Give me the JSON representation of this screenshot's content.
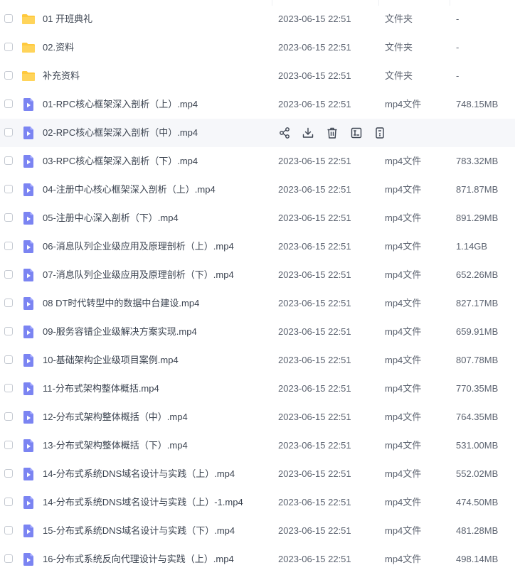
{
  "columns": {
    "date_color": "#5c6370"
  },
  "colors": {
    "folder": "#ffc93d",
    "video": "#7b84f2",
    "hover_row": "#f6f7fa",
    "action_icon": "#3b4350"
  },
  "hover_actions": [
    "share-icon",
    "download-icon",
    "delete-icon",
    "rename-icon",
    "more-icon"
  ],
  "files": [
    {
      "icon": "folder",
      "name": "01 开班典礼",
      "date": "2023-06-15 22:51",
      "type": "文件夹",
      "size": "-"
    },
    {
      "icon": "folder",
      "name": "02.资料",
      "date": "2023-06-15 22:51",
      "type": "文件夹",
      "size": "-"
    },
    {
      "icon": "folder",
      "name": "补充资料",
      "date": "2023-06-15 22:51",
      "type": "文件夹",
      "size": "-"
    },
    {
      "icon": "video",
      "name": "01-RPC核心框架深入剖析（上）.mp4",
      "date": "2023-06-15 22:51",
      "type": "mp4文件",
      "size": "748.15MB"
    },
    {
      "icon": "video",
      "name": "02-RPC核心框架深入剖析（中）.mp4",
      "hovered": true
    },
    {
      "icon": "video",
      "name": "03-RPC核心框架深入剖析（下）.mp4",
      "date": "2023-06-15 22:51",
      "type": "mp4文件",
      "size": "783.32MB"
    },
    {
      "icon": "video",
      "name": "04-注册中心核心框架深入剖析（上）.mp4",
      "date": "2023-06-15 22:51",
      "type": "mp4文件",
      "size": "871.87MB"
    },
    {
      "icon": "video",
      "name": "05-注册中心深入剖析（下）.mp4",
      "date": "2023-06-15 22:51",
      "type": "mp4文件",
      "size": "891.29MB"
    },
    {
      "icon": "video",
      "name": "06-消息队列企业级应用及原理剖析（上）.mp4",
      "date": "2023-06-15 22:51",
      "type": "mp4文件",
      "size": "1.14GB"
    },
    {
      "icon": "video",
      "name": "07-消息队列企业级应用及原理剖析（下）.mp4",
      "date": "2023-06-15 22:51",
      "type": "mp4文件",
      "size": "652.26MB"
    },
    {
      "icon": "video",
      "name": "08 DT时代转型中的数据中台建设.mp4",
      "date": "2023-06-15 22:51",
      "type": "mp4文件",
      "size": "827.17MB"
    },
    {
      "icon": "video",
      "name": "09-服务容错企业级解决方案实现.mp4",
      "date": "2023-06-15 22:51",
      "type": "mp4文件",
      "size": "659.91MB"
    },
    {
      "icon": "video",
      "name": "10-基础架构企业级项目案例.mp4",
      "date": "2023-06-15 22:51",
      "type": "mp4文件",
      "size": "807.78MB"
    },
    {
      "icon": "video",
      "name": "11-分布式架构整体概括.mp4",
      "date": "2023-06-15 22:51",
      "type": "mp4文件",
      "size": "770.35MB"
    },
    {
      "icon": "video",
      "name": "12-分布式架构整体概括（中）.mp4",
      "date": "2023-06-15 22:51",
      "type": "mp4文件",
      "size": "764.35MB"
    },
    {
      "icon": "video",
      "name": "13-分布式架构整体概括（下）.mp4",
      "date": "2023-06-15 22:51",
      "type": "mp4文件",
      "size": "531.00MB"
    },
    {
      "icon": "video",
      "name": "14-分布式系统DNS域名设计与实践（上）.mp4",
      "date": "2023-06-15 22:51",
      "type": "mp4文件",
      "size": "552.02MB"
    },
    {
      "icon": "video",
      "name": "14-分布式系统DNS域名设计与实践（上）-1.mp4",
      "date": "2023-06-15 22:51",
      "type": "mp4文件",
      "size": "474.50MB"
    },
    {
      "icon": "video",
      "name": "15-分布式系统DNS域名设计与实践（下）.mp4",
      "date": "2023-06-15 22:51",
      "type": "mp4文件",
      "size": "481.28MB"
    },
    {
      "icon": "video",
      "name": "16-分布式系统反向代理设计与实践（上）.mp4",
      "date": "2023-06-15 22:51",
      "type": "mp4文件",
      "size": "498.14MB"
    }
  ]
}
